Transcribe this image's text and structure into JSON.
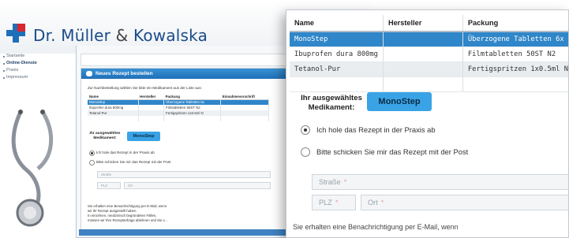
{
  "site": {
    "title_part1": "Dr. Müller",
    "title_amp": "&",
    "title_part2": "Kowalska"
  },
  "nav": [
    {
      "label": "Startseite",
      "active": false
    },
    {
      "label": "Online-Dienste",
      "active": true
    },
    {
      "label": "Praxis",
      "active": false
    },
    {
      "label": "Impressum",
      "active": false
    }
  ],
  "panel": {
    "title": "Neues Rezept bestellen",
    "intro": "Zur Nachbestellung wählen Sie bitte ein Medikament aus der Liste aus:"
  },
  "table": {
    "headers": [
      "Name",
      "Hersteller",
      "Packung",
      "Einnahmevorschrift"
    ],
    "fg_headers": [
      "Name",
      "Hersteller",
      "Packung"
    ],
    "rows": [
      {
        "name": "MonoStep",
        "hersteller": "",
        "packung": "Überzogene Tabletten 6x",
        "packung_short": "Überzogene Tabletten 6x",
        "selected": true
      },
      {
        "name": "Ibuprofen dura 800mg",
        "hersteller": "",
        "packung": "Filmtabletten 50ST N2",
        "packung_short": "Filmtabletten 50ST N2",
        "selected": false
      },
      {
        "name": "Tetanol-Pur",
        "hersteller": "",
        "packung": "Fertigspritzen 1x0.5ml N",
        "packung_short": "Fertigspritzen 1x0.5ml N",
        "selected": false
      },
      {
        "name": "",
        "hersteller": "",
        "packung": "",
        "packung_short": "",
        "selected": false
      }
    ]
  },
  "selection": {
    "label": "Ihr ausgewähltes Medikament:",
    "value": "MonoStep"
  },
  "delivery": {
    "option_pickup": "Ich hole das Rezept in der Praxis ab",
    "option_mail": "Bitte schicken Sie mir das Rezept mit der Post",
    "pickup_checked": true
  },
  "address": {
    "street_placeholder": "Straße",
    "zip_placeholder": "PLZ",
    "city_placeholder": "Ort",
    "required_mark": "*"
  },
  "note": {
    "line1": "Sie erhalten eine Benachrichtigung per E-Mail, wenn",
    "line2": "wir Ihr Rezept ausgestellt haben.",
    "line3": "In einzelnen, medizinisch begründeten Fällen,",
    "line4": "müssen wir Ihre Rezeptanfrage ablehnen und Sie v...",
    "fg_partial": "Sie erhalten eine Benachrichtigung per E-Mail, wenn"
  },
  "colors": {
    "brand_blue": "#1f6fb8",
    "selected_row": "#2f86c9",
    "badge": "#3aa3e6",
    "logo_red": "#d8262f"
  }
}
